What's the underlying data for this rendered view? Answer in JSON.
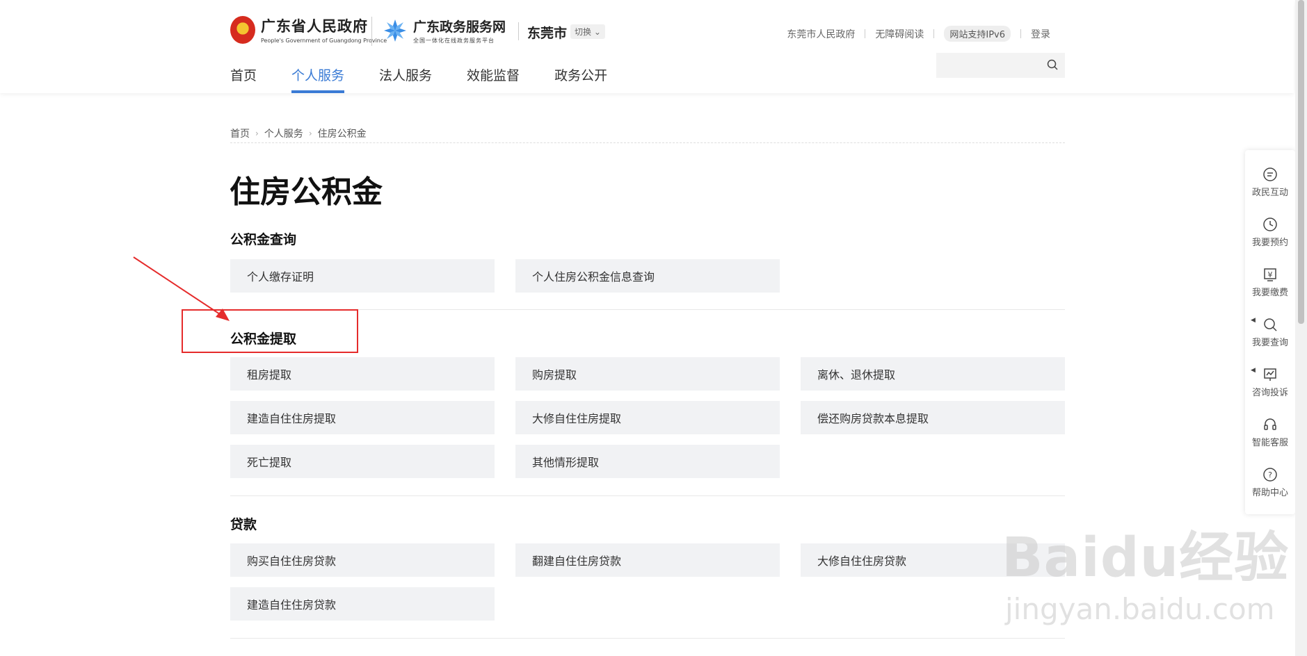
{
  "header": {
    "gov_name_cn": "广东省人民政府",
    "gov_name_en": "People's Government of Guangdong Province",
    "svc_name_cn": "广东政务服务网",
    "svc_sub": "全国一体化在线政务服务平台",
    "city": "东莞市",
    "city_switch": "切换",
    "top_links": [
      "东莞市人民政府",
      "无障碍阅读",
      "网站支持IPv6",
      "登录"
    ],
    "nav": [
      {
        "label": "首页",
        "active": false
      },
      {
        "label": "个人服务",
        "active": true
      },
      {
        "label": "法人服务",
        "active": false
      },
      {
        "label": "效能监督",
        "active": false
      },
      {
        "label": "政务公开",
        "active": false
      }
    ],
    "search_placeholder": ""
  },
  "breadcrumb": [
    "首页",
    "个人服务",
    "住房公积金"
  ],
  "page_title": "住房公积金",
  "sections": [
    {
      "title": "公积金查询",
      "items": [
        "个人缴存证明",
        "个人住房公积金信息查询"
      ]
    },
    {
      "title": "公积金提取",
      "items": [
        "租房提取",
        "购房提取",
        "离休、退休提取",
        "建造自住住房提取",
        "大修自住住房提取",
        "偿还购房贷款本息提取",
        "死亡提取",
        "其他情形提取"
      ]
    },
    {
      "title": "贷款",
      "items": [
        "购买自住住房贷款",
        "翻建自住住房贷款",
        "大修自住住房贷款",
        "建造自住住房贷款"
      ]
    }
  ],
  "sidebar": [
    {
      "label": "政民互动",
      "icon": "chat-icon"
    },
    {
      "label": "我要预约",
      "icon": "clock-icon"
    },
    {
      "label": "我要缴费",
      "icon": "yen-icon"
    },
    {
      "label": "我要查询",
      "icon": "search-icon"
    },
    {
      "label": "咨询投诉",
      "icon": "complaint-icon"
    },
    {
      "label": "智能客服",
      "icon": "headset-icon"
    },
    {
      "label": "帮助中心",
      "icon": "help-icon"
    }
  ],
  "watermark": {
    "main": "Baidu经验",
    "sub": "jingyan.baidu.com"
  },
  "colors": {
    "accent": "#3a7bd5",
    "annotation": "#e52b2b",
    "card_bg": "#f1f2f4"
  }
}
